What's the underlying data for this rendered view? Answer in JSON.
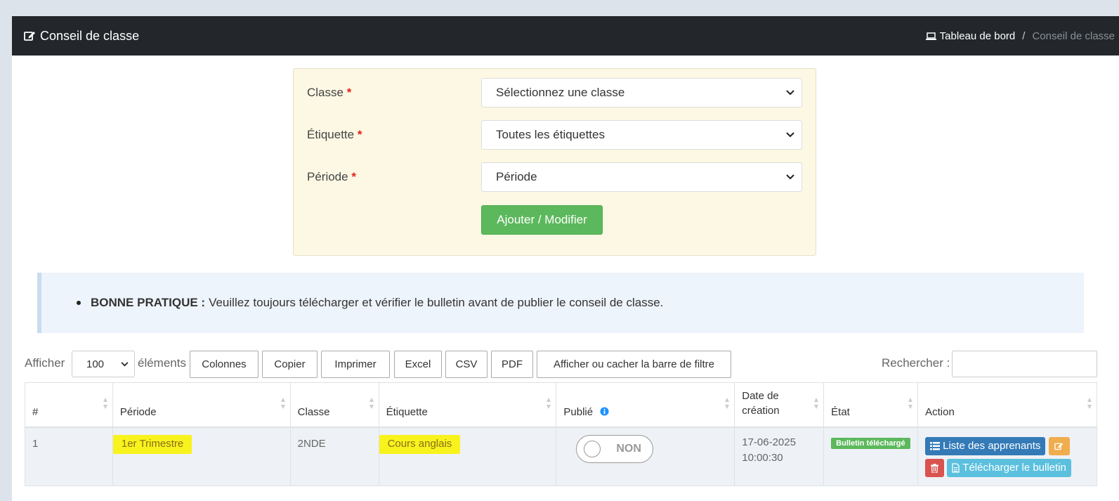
{
  "header": {
    "title": "Conseil de classe",
    "breadcrumb_home": "Tableau de bord",
    "breadcrumb_sep": "/",
    "breadcrumb_current": "Conseil de classe"
  },
  "form": {
    "classe_label": "Classe",
    "classe_value": "Sélectionnez une classe",
    "etiquette_label": "Étiquette",
    "etiquette_value": "Toutes les étiquettes",
    "periode_label": "Période",
    "periode_value": "Période",
    "required_mark": "*",
    "submit_label": "Ajouter / Modifier"
  },
  "tip": {
    "bold": "BONNE PRATIQUE :",
    "text": "Veuillez toujours télécharger et vérifier le bulletin avant de publier le conseil de classe."
  },
  "toolbar": {
    "show_label": "Afficher",
    "page_length": "100",
    "elements_label": "éléments",
    "buttons": [
      "Colonnes",
      "Copier",
      "Imprimer",
      "Excel",
      "CSV",
      "PDF",
      "Afficher ou cacher la barre de filtre"
    ],
    "search_label": "Rechercher :"
  },
  "table": {
    "headers": [
      "#",
      "Période",
      "Classe",
      "Étiquette",
      "Publié",
      "Date de création",
      "État",
      "Action"
    ],
    "date_header_line1": "Date de",
    "date_header_line2": "création",
    "rows": [
      {
        "num": "1",
        "periode": "1er Trimestre",
        "classe": "2NDE",
        "etiquette": "Cours anglais",
        "publie": "NON",
        "date_line1": "17-06-2025",
        "date_line2": "10:00:30",
        "etat": "Bulletin téléchargé",
        "action_list": "Liste des apprenants",
        "action_download": "Télécharger le bulletin"
      }
    ]
  },
  "colors": {
    "header_bg": "#23272b",
    "success": "#5cb85c",
    "primary": "#337ab7",
    "warning": "#f0ad4e",
    "danger": "#d9534f",
    "info": "#5bc0de",
    "highlight": "#f8f31c"
  },
  "icons": [
    "edit-icon",
    "laptop-icon",
    "chevron-down-icon",
    "info-icon",
    "sort-icon",
    "list-icon",
    "trash-icon",
    "file-icon"
  ]
}
